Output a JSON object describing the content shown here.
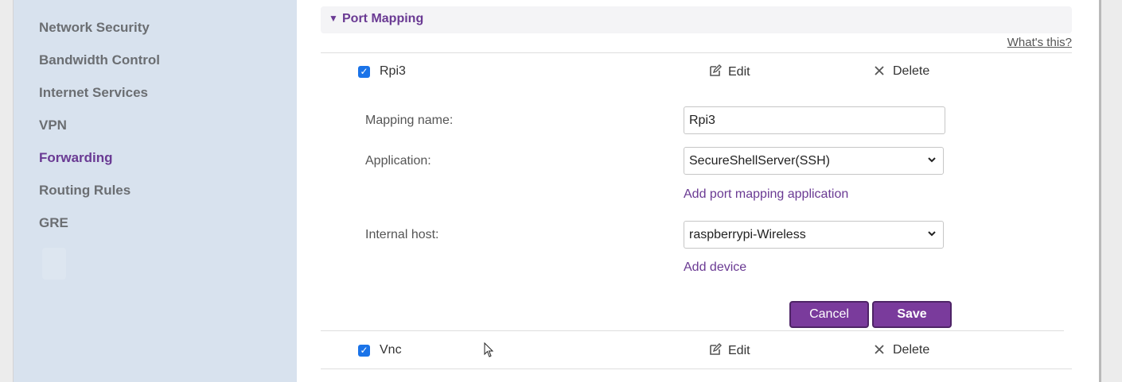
{
  "sidebar": {
    "items": [
      {
        "label": "Network Security",
        "active": false
      },
      {
        "label": "Bandwidth Control",
        "active": false
      },
      {
        "label": "Internet Services",
        "active": false
      },
      {
        "label": "VPN",
        "active": false
      },
      {
        "label": "Forwarding",
        "active": true
      },
      {
        "label": "Routing Rules",
        "active": false
      },
      {
        "label": "GRE",
        "active": false
      }
    ]
  },
  "section": {
    "title": "Port Mapping",
    "whats_this": "What's this?"
  },
  "mappings": [
    {
      "name": "Rpi3",
      "checked": true,
      "edit_label": "Edit",
      "delete_label": "Delete"
    },
    {
      "name": "Vnc",
      "checked": true,
      "edit_label": "Edit",
      "delete_label": "Delete"
    }
  ],
  "form": {
    "mapping_name_label": "Mapping name:",
    "mapping_name_value": "Rpi3",
    "application_label": "Application:",
    "application_value": "SecureShellServer(SSH)",
    "add_application_link": "Add port mapping application",
    "internal_host_label": "Internal host:",
    "internal_host_value": "raspberrypi-Wireless",
    "add_device_link": "Add device",
    "cancel_label": "Cancel",
    "save_label": "Save"
  },
  "colors": {
    "accent": "#6a3a93",
    "button": "#7a3b9c",
    "sidebar_bg": "#d8e2ee",
    "checkbox": "#1a73e8"
  }
}
